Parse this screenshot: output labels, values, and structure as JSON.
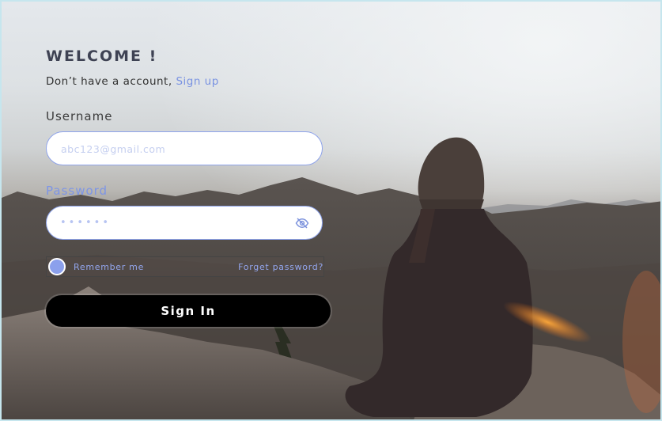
{
  "form": {
    "heading": "WELCOME !",
    "signup_prompt": "Don’t have a account, ",
    "signup_link": "Sign up",
    "username_label": "Username",
    "username_placeholder": "abc123@gmail.com",
    "password_label": "Password",
    "password_mask": "••••••",
    "remember_label": "Remember me",
    "forgot_link": "Forget password?",
    "signin_label": "Sign In"
  },
  "colors": {
    "accent": "#7a93e2",
    "button": "#000000",
    "heading": "#3e4253"
  },
  "icons": {
    "password_toggle": "eye-slash-icon"
  }
}
